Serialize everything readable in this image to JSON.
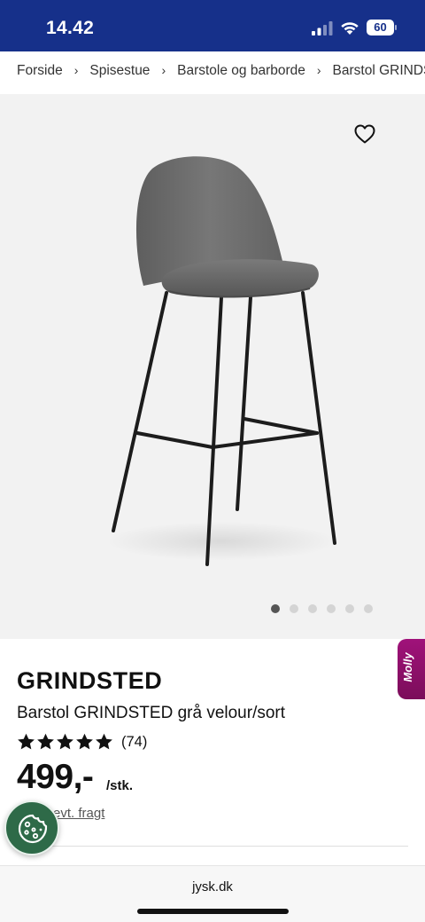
{
  "status_bar": {
    "time": "14.42",
    "battery": "60",
    "icons": [
      "signal-icon",
      "wifi-icon",
      "battery-icon"
    ],
    "background": "#16308a"
  },
  "breadcrumb": {
    "items": [
      "Forside",
      "Spisestue",
      "Barstole og barborde",
      "Barstol GRINDSTED"
    ]
  },
  "gallery": {
    "image": "bar-stool-photo",
    "slide_count": 6,
    "active_slide": 1
  },
  "product": {
    "brand": "GRINDSTED",
    "title": "Barstol GRINDSTED grå velour/sort",
    "rating_stars": 5,
    "review_count": "(74)",
    "price": "499,-",
    "price_unit": "/stk.",
    "shipping_link": "evt. fragt"
  },
  "chat": {
    "label": "Molly",
    "color": "#a0127a"
  },
  "cookie": {
    "icon": "cookie-icon",
    "color": "#2e6a48"
  },
  "browser": {
    "url": "jysk.dk"
  }
}
